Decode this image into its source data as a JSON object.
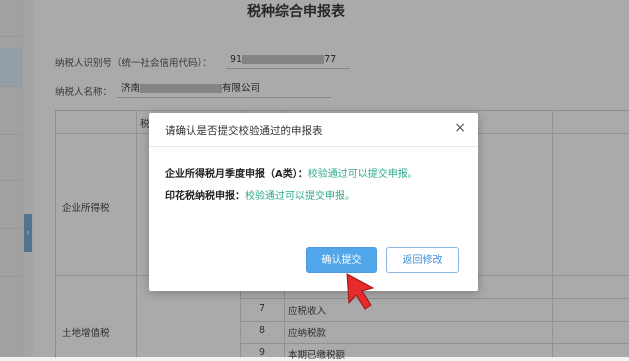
{
  "form": {
    "title": "税种综合申报表",
    "taxpayer_id_label": "纳税人识别号（统一社会信用代码）：",
    "taxpayer_id_prefix": "91",
    "taxpayer_id_suffix": "77",
    "taxpayer_name_label": "纳税人名称：",
    "taxpayer_name_prefix": "济南",
    "taxpayer_name_suffix": "有限公司"
  },
  "table": {
    "header_fragment": "税",
    "row_groups": [
      {
        "tax": "企业所得税",
        "rows": []
      },
      {
        "tax": "土地增值税",
        "rows": [
          {
            "no": "7",
            "item": "应税收入"
          },
          {
            "no": "8",
            "item": "应纳税款"
          },
          {
            "no": "9",
            "item": "本期已缴税额"
          }
        ]
      }
    ]
  },
  "dialog": {
    "title": "请确认是否提交校验通过的申报表",
    "close_symbol": "×",
    "items": [
      {
        "label": "企业所得税月季度申报（A类）：",
        "status": "校验通过可以提交申报。"
      },
      {
        "label": "印花税纳税申报：",
        "status": "校验通过可以提交申报。"
      }
    ],
    "confirm_label": "确认提交",
    "back_label": "返回修改"
  },
  "colors": {
    "accent": "#52a6ea",
    "success": "#2fa88a",
    "arrow": "#e52b2b"
  },
  "icons": {
    "close": "close-icon",
    "cursor": "red-arrow-cursor-icon",
    "collapse": "chevron-left-icon"
  }
}
